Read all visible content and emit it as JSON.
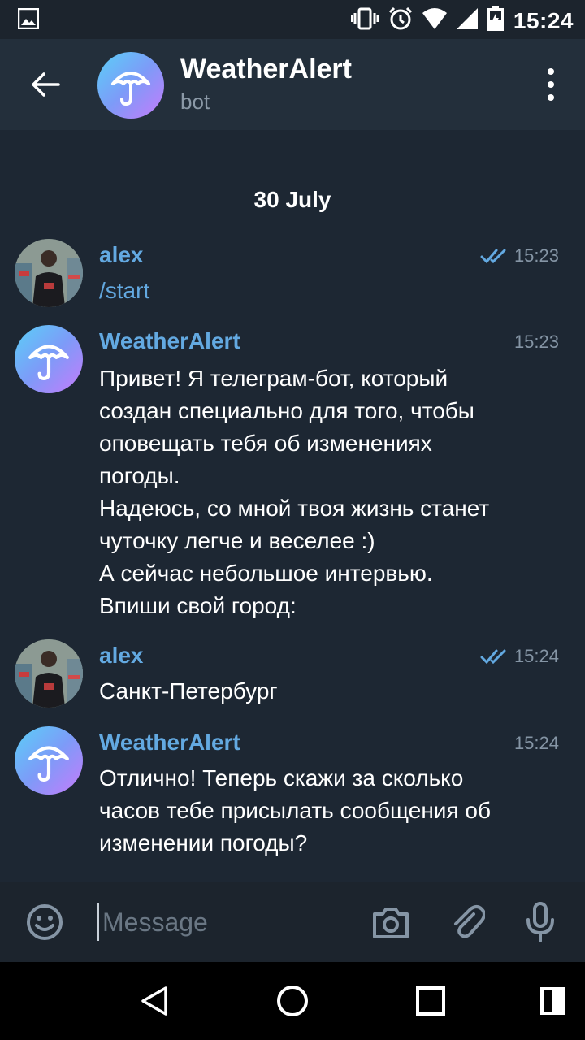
{
  "status_bar": {
    "time": "15:24"
  },
  "header": {
    "title": "WeatherAlert",
    "subtitle": "bot"
  },
  "date_separator": "30 July",
  "messages": [
    {
      "sender": "alex",
      "time": "15:23",
      "text": "/start"
    },
    {
      "sender": "WeatherAlert",
      "time": "15:23",
      "text": "Привет! Я телеграм-бот, который\nсоздан специально для того, чтобы\nоповещать тебя об изменениях\nпогоды.\nНадеюсь, со мной твоя жизнь станет\nчуточку легче и веселее :)\nА сейчас небольшое интервью.\nВпиши свой город:"
    },
    {
      "sender": "alex",
      "time": "15:24",
      "text": "Санкт-Петербург"
    },
    {
      "sender": "WeatherAlert",
      "time": "15:24",
      "text": "Отлично! Теперь скажи за сколько\nчасов тебе присылать сообщения об\nизменении погоды?"
    }
  ],
  "input": {
    "placeholder": "Message"
  },
  "icons": {
    "status": [
      "image-icon",
      "vibrate-icon",
      "alarm-icon",
      "wifi-icon",
      "signal-icon",
      "battery-icon"
    ],
    "header": [
      "back-arrow-icon",
      "umbrella-icon",
      "more-vert-icon"
    ],
    "input_bar": [
      "emoji-icon",
      "camera-icon",
      "attach-icon",
      "mic-icon"
    ],
    "nav": [
      "back-triangle-icon",
      "home-circle-icon",
      "recents-square-icon",
      "split-icon"
    ]
  },
  "colors": {
    "background": "#1d2733",
    "header": "#232f3b",
    "accent": "#63a9e1",
    "muted": "#8595a5"
  }
}
